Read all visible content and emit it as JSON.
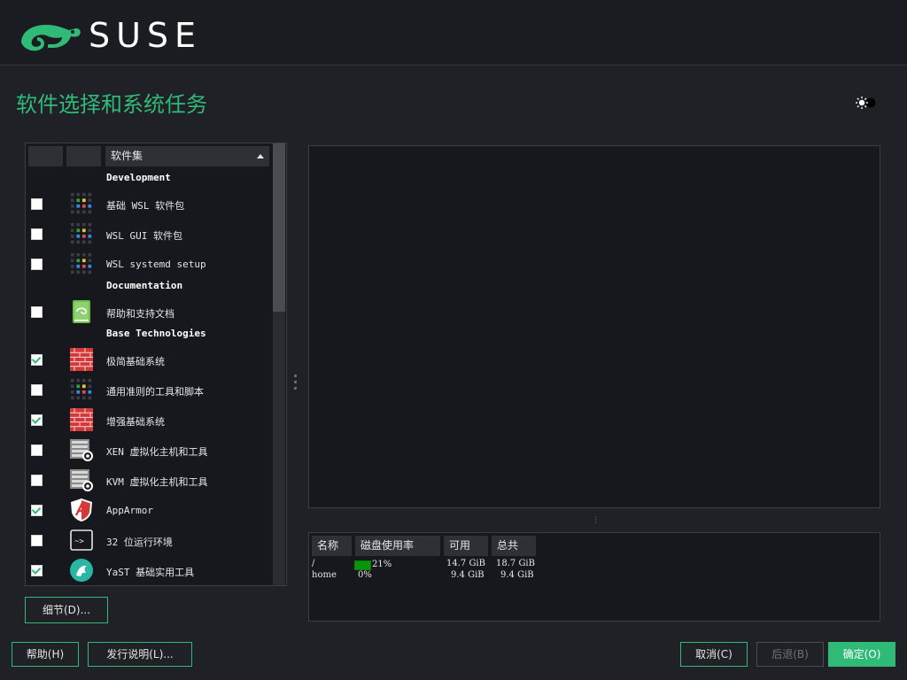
{
  "brand": {
    "logo_text": "SUSE"
  },
  "page": {
    "title": "软件选择和系统任务"
  },
  "table": {
    "column_header": "软件集",
    "rows": [
      {
        "type": "category",
        "label": "Development"
      },
      {
        "type": "pattern",
        "label": "基础 WSL 软件包",
        "checked": false,
        "icon": "grid-package-icon"
      },
      {
        "type": "pattern",
        "label": "WSL GUI 软件包",
        "checked": false,
        "icon": "grid-package-icon"
      },
      {
        "type": "pattern",
        "label": "WSL systemd setup",
        "checked": false,
        "icon": "grid-package-icon"
      },
      {
        "type": "category",
        "label": "Documentation"
      },
      {
        "type": "pattern",
        "label": "帮助和支持文档",
        "checked": false,
        "icon": "help-book-icon"
      },
      {
        "type": "category",
        "label": "Base Technologies"
      },
      {
        "type": "pattern",
        "label": "极简基础系统",
        "checked": true,
        "icon": "brick-wall-icon"
      },
      {
        "type": "pattern",
        "label": "通用准则的工具和脚本",
        "checked": false,
        "icon": "grid-package-icon"
      },
      {
        "type": "pattern",
        "label": "增强基础系统",
        "checked": true,
        "icon": "brick-wall-icon"
      },
      {
        "type": "pattern",
        "label": "XEN 虚拟化主机和工具",
        "checked": false,
        "icon": "server-gear-icon"
      },
      {
        "type": "pattern",
        "label": "KVM 虚拟化主机和工具",
        "checked": false,
        "icon": "server-gear-icon"
      },
      {
        "type": "pattern",
        "label": "AppArmor",
        "checked": true,
        "icon": "apparmor-shield-icon"
      },
      {
        "type": "pattern",
        "label": "32 位运行环境",
        "checked": false,
        "icon": "terminal-icon"
      },
      {
        "type": "pattern",
        "label": "YaST 基础实用工具",
        "checked": true,
        "icon": "yast-gecko-icon"
      }
    ]
  },
  "disk": {
    "headers": {
      "name": "名称",
      "usage": "磁盘使用率",
      "free": "可用",
      "total": "总共"
    },
    "rows": [
      {
        "name": "/",
        "usage": "21%",
        "usage_fraction": 0.21,
        "free": "14.7 GiB",
        "total": "18.7 GiB"
      },
      {
        "name": "home",
        "usage": "0%",
        "usage_fraction": 0,
        "free": "9.4 GiB",
        "total": "9.4 GiB"
      }
    ]
  },
  "buttons": {
    "details": "细节(D)...",
    "help": "帮助(H)",
    "release_notes": "发行说明(L)...",
    "cancel": "取消(C)",
    "back": "后退(B)",
    "ok": "确定(O)"
  },
  "colors": {
    "accent": "#30ba78",
    "background": "#1f2127",
    "panel": "#16181d",
    "usage_bar": "#079607"
  }
}
